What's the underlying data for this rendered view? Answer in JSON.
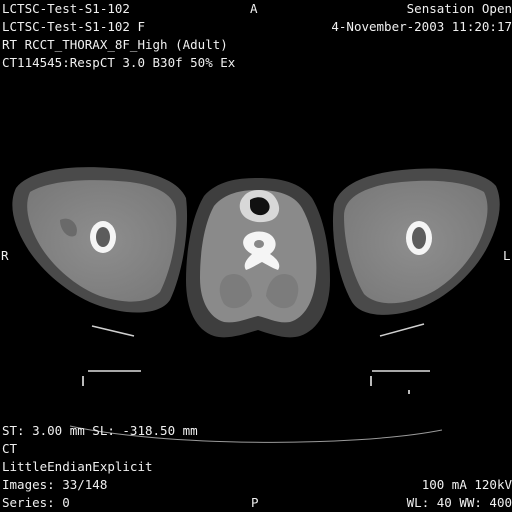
{
  "overlay": {
    "top_left": [
      "LCTSC-Test-S1-102",
      "LCTSC-Test-S1-102 F",
      "RT RCCT_THORAX_8F_High (Adult)",
      "CT114545:RespCT  3.0  B30f  50% Ex"
    ],
    "top_right": [
      "Sensation Open",
      "4-November-2003 11:20:17"
    ],
    "bottom_left": [
      "ST: 3.00 mm SL: -318.50 mm",
      "CT",
      "LittleEndianExplicit",
      "Images: 33/148",
      "Series: 0"
    ],
    "bottom_right": [
      "100 mA 120kV",
      "WL: 40 WW: 400"
    ]
  },
  "orientation": {
    "top": "A",
    "bottom": "P",
    "left": "R",
    "right": "L"
  },
  "colors": {
    "background": "#000000",
    "overlay_text": "#f0f0f0",
    "soft_tissue": "#8c8c8c",
    "fat": "#3a3a3a",
    "bone": "#f5f5f5"
  }
}
